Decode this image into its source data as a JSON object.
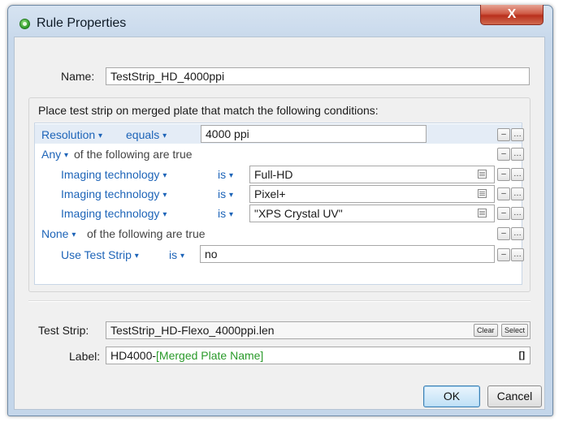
{
  "window": {
    "title": "Rule Properties",
    "close_label": "X",
    "app_icon": "green-dot-icon"
  },
  "name_field": {
    "label": "Name:",
    "value": "TestStrip_HD_4000ppi"
  },
  "conditions": {
    "heading": "Place test strip on merged plate that match the following conditions:",
    "caret": "▾",
    "minus": "–",
    "more": "…",
    "rows": [
      {
        "field": "Resolution",
        "operator": "equals",
        "value": "4000 ppi"
      },
      {
        "quantifier": "Any",
        "suffix": "of the following are true"
      },
      {
        "field": "Imaging technology",
        "operator": "is",
        "value": "Full-HD"
      },
      {
        "field": "Imaging technology",
        "operator": "is",
        "value": "Pixel+"
      },
      {
        "field": "Imaging technology",
        "operator": "is",
        "value": "\"XPS Crystal UV\""
      },
      {
        "quantifier": "None",
        "suffix": "of the following are true"
      },
      {
        "field": "Use Test Strip",
        "operator": "is",
        "value": "no"
      }
    ]
  },
  "test_strip": {
    "label": "Test Strip:",
    "value": "TestStrip_HD-Flexo_4000ppi.len",
    "clear_label": "Clear",
    "select_label": "Select"
  },
  "label_field": {
    "label": "Label:",
    "prefix": "HD4000-",
    "variable": "[Merged Plate Name]",
    "insert_icon_text": "[]"
  },
  "buttons": {
    "ok": "OK",
    "cancel": "Cancel"
  },
  "colors": {
    "accent_blue": "#1d64b8",
    "variable_green": "#2a9a2a",
    "close_red": "#c9442f"
  }
}
